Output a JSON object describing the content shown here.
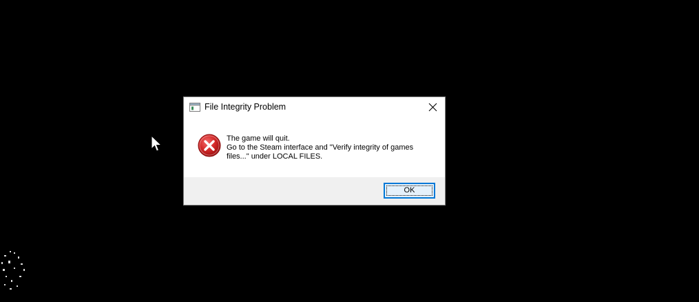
{
  "dialog": {
    "title": "File Integrity Problem",
    "icon": "error-icon",
    "message_lines": [
      "The game will quit.",
      "Go to the Steam interface and \"Verify integrity of games",
      "files...\" under LOCAL FILES."
    ],
    "ok_label": "OK"
  },
  "colors": {
    "background": "#000000",
    "dialog_body": "#ffffff",
    "dialog_footer": "#f0f0f0",
    "button_accent": "#0078d7",
    "error_red": "#c4161c"
  }
}
